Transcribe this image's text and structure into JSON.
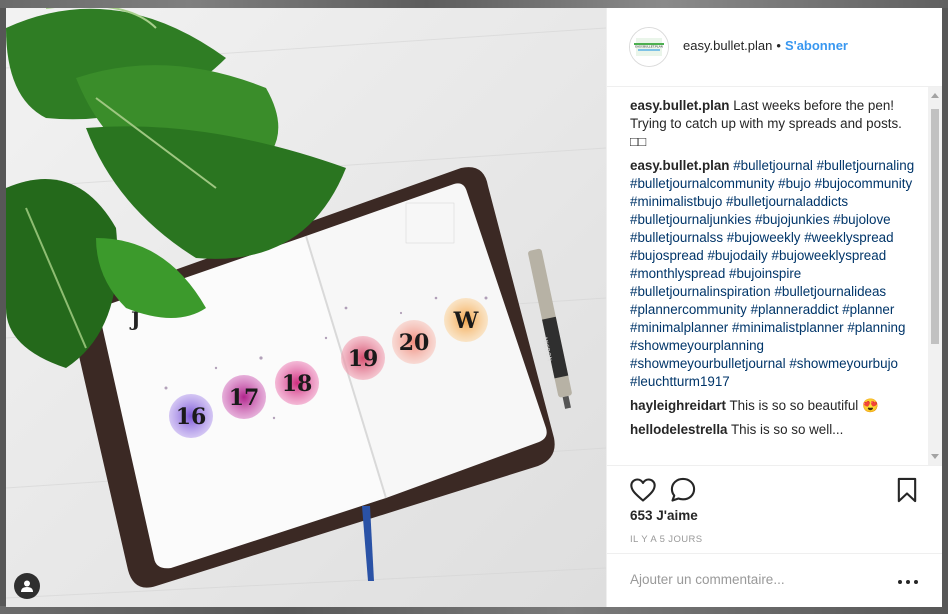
{
  "post": {
    "username": "easy.bullet.plan",
    "separator": "•",
    "follow_label": "S'abonner",
    "avatar_text": "EASY.BULLET.PLAN",
    "comments": [
      {
        "user": "easy.bullet.plan",
        "text": "Last weeks before the pen! Trying to catch up with my spreads and posts. □□"
      },
      {
        "user": "easy.bullet.plan",
        "tags": [
          "#bulletjournal",
          "#bulletjournaling",
          "#bulletjournalcommunity",
          "#bujo",
          "#bujocommunity",
          "#minimalistbujo",
          "#bulletjournaladdicts",
          "#bulletjournaljunkies",
          "#bujojunkies",
          "#bujolove",
          "#bulletjournalss",
          "#bujoweekly",
          "#weeklyspread",
          "#bujospread",
          "#bujodaily",
          "#bujoweeklyspread",
          "#monthlyspread",
          "#bujoinspire",
          "#bulletjournalinspiration",
          "#bulletjournalideas",
          "#plannercommunity",
          "#planneraddict",
          "#planner",
          "#minimalplanner",
          "#minimalistplanner",
          "#planning",
          "#showmeyourplanning",
          "#showmeyourbulletjournal",
          "#showmeyourbujo",
          "#leuchtturm1917"
        ]
      },
      {
        "user": "hayleighreidart",
        "text": "This is so so beautiful 😍"
      },
      {
        "user": "hellodelestrella",
        "text": "This is so so well..."
      }
    ],
    "likes": "653 J'aime",
    "time_ago": "IL Y A 5 JOURS",
    "add_comment_placeholder": "Ajouter un commentaire...",
    "dates": [
      "16",
      "17",
      "18",
      "19",
      "20",
      "W"
    ],
    "journal_letter": "J",
    "pen_label": "MICRON"
  },
  "icons": [
    "heart-icon",
    "comment-icon",
    "bookmark-icon",
    "more-options-icon",
    "tag-people-icon"
  ],
  "colors": {
    "accent": "#3897f0",
    "hashtag": "#003569",
    "text": "#262626",
    "muted": "#999999"
  }
}
